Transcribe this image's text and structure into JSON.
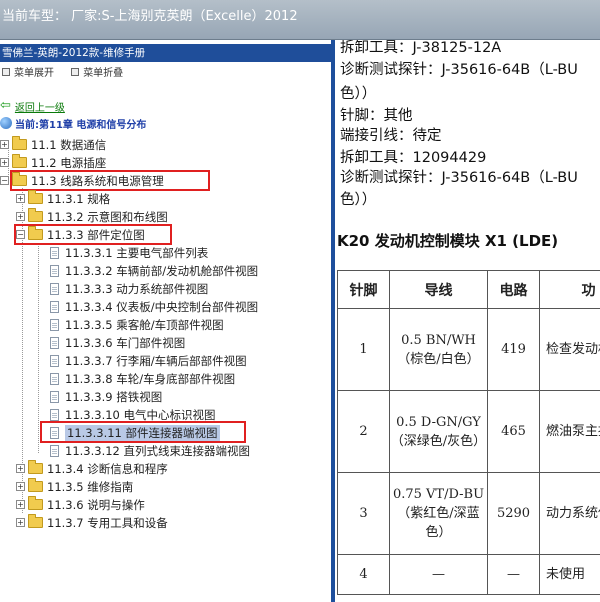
{
  "topbar": {
    "title": "当前车型：  厂家:S-上海别克英朗（Excelle）2012"
  },
  "left": {
    "manual_title": "雪佛兰-英朗-2012款-维修手册",
    "menu_expand": "菜单展开",
    "menu_collapse": "菜单折叠",
    "back_label": "返回上一级",
    "current_label": "当前:第11章 电源和信号分布",
    "tree": [
      {
        "label": "11.1 数据通信",
        "type": "folder",
        "toggle": "+"
      },
      {
        "label": "11.2 电源插座",
        "type": "folder",
        "toggle": "+"
      },
      {
        "label": "11.3 线路系统和电源管理",
        "type": "folder",
        "toggle": "-"
      },
      {
        "label": "11.3.1 规格",
        "type": "folder",
        "toggle": "+"
      },
      {
        "label": "11.3.2 示意图和布线图",
        "type": "folder",
        "toggle": "+"
      },
      {
        "label": "11.3.3 部件定位图",
        "type": "folder",
        "toggle": "-"
      },
      {
        "label": "11.3.3.1 主要电气部件列表",
        "type": "doc"
      },
      {
        "label": "11.3.3.2 车辆前部/发动机舱部件视图",
        "type": "doc"
      },
      {
        "label": "11.3.3.3 动力系统部件视图",
        "type": "doc"
      },
      {
        "label": "11.3.3.4 仪表板/中央控制台部件视图",
        "type": "doc"
      },
      {
        "label": "11.3.3.5 乘客舱/车顶部件视图",
        "type": "doc"
      },
      {
        "label": "11.3.3.6 车门部件视图",
        "type": "doc"
      },
      {
        "label": "11.3.3.7 行李厢/车辆后部部件视图",
        "type": "doc"
      },
      {
        "label": "11.3.3.8 车轮/车身底部部件视图",
        "type": "doc"
      },
      {
        "label": "11.3.3.9 搭铁视图",
        "type": "doc"
      },
      {
        "label": "11.3.3.10 电气中心标识视图",
        "type": "doc"
      },
      {
        "label": "11.3.3.11 部件连接器端视图",
        "type": "doc"
      },
      {
        "label": "11.3.3.12 直列式线束连接器端视图",
        "type": "doc"
      },
      {
        "label": "11.3.4 诊断信息和程序",
        "type": "folder",
        "toggle": "+"
      },
      {
        "label": "11.3.5 维修指南",
        "type": "folder",
        "toggle": "+"
      },
      {
        "label": "11.3.6 说明与操作",
        "type": "folder",
        "toggle": "+"
      },
      {
        "label": "11.3.7 专用工具和设备",
        "type": "folder",
        "toggle": "+"
      }
    ]
  },
  "right": {
    "lines_top": [
      "拆卸工具：J-38125-12A",
      "诊断测试探针：J-35616-64B（L-BU",
      "色））",
      "针脚：其他",
      "端接引线：待定",
      "拆卸工具：12094429",
      "诊断测试探针：J-35616-64B（L-BU",
      "色））"
    ],
    "section_title": "K20 发动机控制模块 X1 (LDE)",
    "table": {
      "headers": [
        "针脚",
        "导线",
        "电路",
        "功"
      ],
      "rows": [
        {
          "pin": "1",
          "wire": "0.5 BN/WH（棕色/白色）",
          "circuit": "419",
          "function": "检查发动机控制 (LDE)"
        },
        {
          "pin": "2",
          "wire": "0.5 D-GN/GY（深绿色/灰色）",
          "circuit": "465",
          "function": "燃油泵主控制 (LDE)"
        },
        {
          "pin": "3",
          "wire": "0.75 VT/D-BU（紫红色/深蓝色）",
          "circuit": "5290",
          "function": "动力系统保险丝电 (LDE)"
        },
        {
          "pin": "4",
          "wire": "—",
          "circuit": "—",
          "function": "未使用"
        }
      ]
    }
  }
}
